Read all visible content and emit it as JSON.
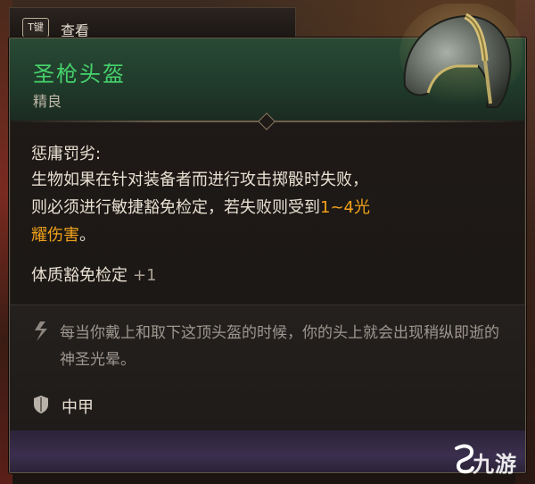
{
  "hotkey": {
    "key": "T键",
    "action": "查看"
  },
  "item": {
    "name": "圣枪头盔",
    "rarity": "精良",
    "name_color": "#46d26c"
  },
  "ability": {
    "title": "惩庸罚劣:",
    "desc_part1": "生物如果在针对装备者而进行攻击掷骰时失败，则必须进行敏捷豁免检定，若失败则受到",
    "desc_highlight": "1~4光耀伤害",
    "desc_part2": "。",
    "highlight_color": "#f1a21a"
  },
  "bonus": {
    "label": "体质豁免检定",
    "value": "+1"
  },
  "flavor": {
    "icon": "quote-icon",
    "text": "每当你戴上和取下这顶头盔的时候，你的头上就会出现稍纵即逝的神圣光晕。"
  },
  "armor": {
    "icon": "shield-icon",
    "type": "中甲"
  },
  "watermark": {
    "text": "九游"
  }
}
